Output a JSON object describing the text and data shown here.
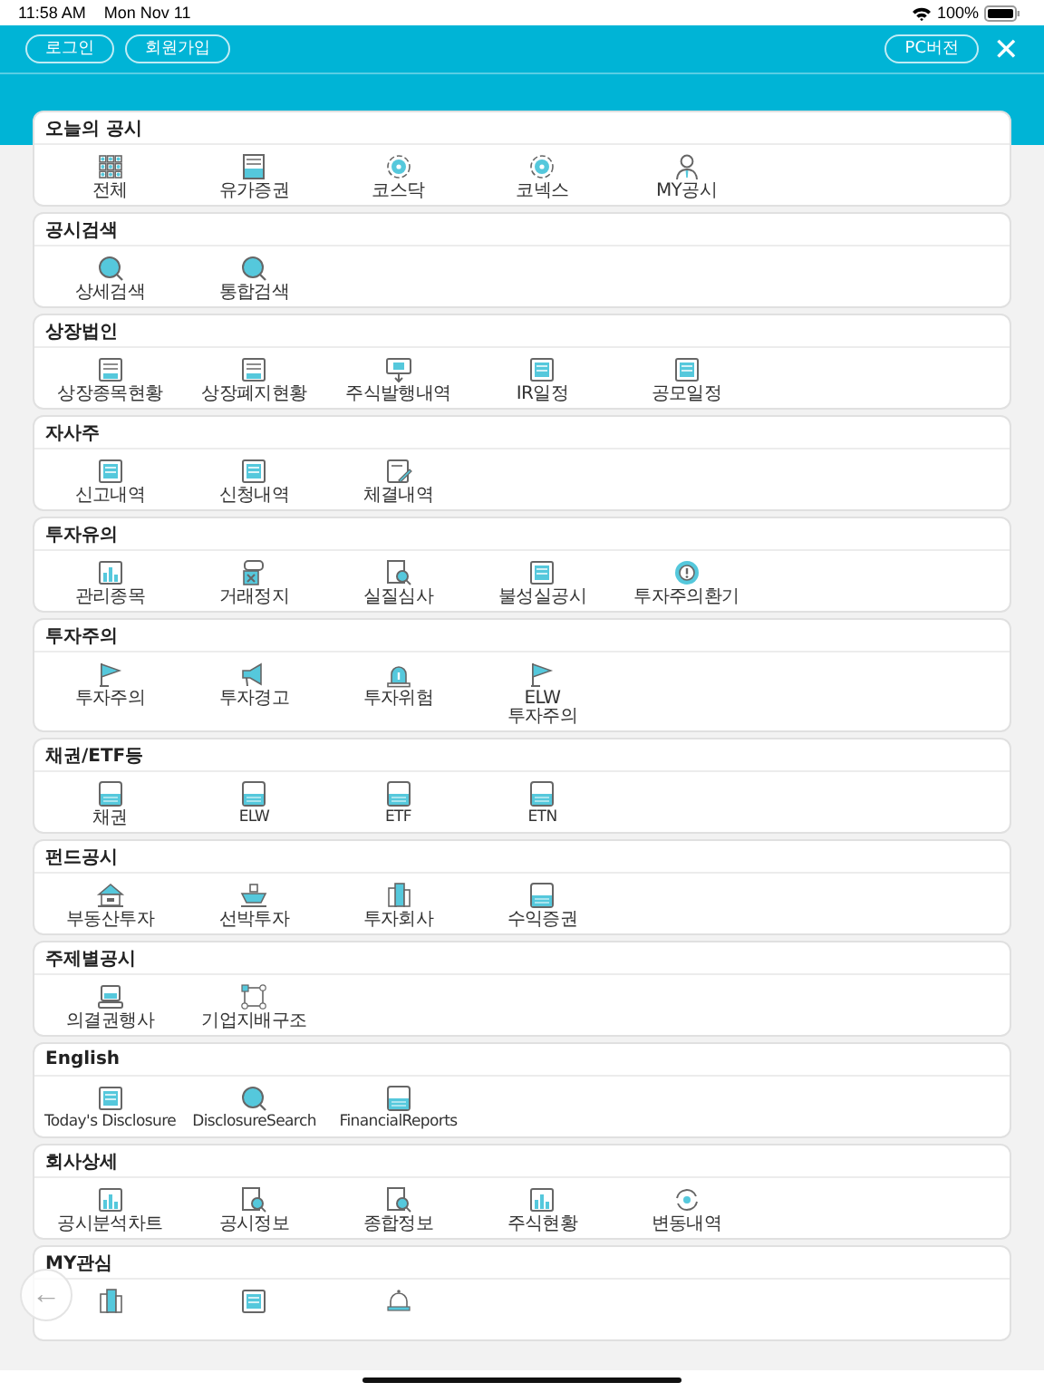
{
  "status_bar": {
    "time": "11:58 AM",
    "date": "Mon Nov 11",
    "battery": "100%"
  },
  "header": {
    "buttons": [
      "로그인",
      "회원가입"
    ],
    "pc_button": "PC버전",
    "close": "✕"
  },
  "sections": [
    {
      "title": "오늘의 공시",
      "items": [
        {
          "label": "전체",
          "kind": "grid"
        },
        {
          "label": "유가증권",
          "kind": "ledger"
        },
        {
          "label": "코스닥",
          "kind": "target"
        },
        {
          "label": "코넥스",
          "kind": "target"
        },
        {
          "label": "MY공시",
          "kind": "person"
        }
      ]
    },
    {
      "title": "공시검색",
      "items": [
        {
          "label": "상세검색",
          "kind": "search"
        },
        {
          "label": "통합검색",
          "kind": "search"
        }
      ]
    },
    {
      "title": "상장법인",
      "items": [
        {
          "label": "상장종목현황",
          "kind": "list"
        },
        {
          "label": "상장폐지현황",
          "kind": "list"
        },
        {
          "label": "주식발행내역",
          "kind": "monitor"
        },
        {
          "label": "IR일정",
          "kind": "document"
        },
        {
          "label": "공모일정",
          "kind": "document"
        }
      ]
    },
    {
      "title": "자사주",
      "items": [
        {
          "label": "신고내역",
          "kind": "document"
        },
        {
          "label": "신청내역",
          "kind": "document"
        },
        {
          "label": "체결내역",
          "kind": "pen"
        }
      ]
    },
    {
      "title": "투자유의",
      "items": [
        {
          "label": "관리종목",
          "kind": "chart"
        },
        {
          "label": "거래정지",
          "kind": "stop"
        },
        {
          "label": "실질심사",
          "kind": "docsearch"
        },
        {
          "label": "불성실공시",
          "kind": "document"
        },
        {
          "label": "투자주의환기",
          "kind": "alert"
        }
      ]
    },
    {
      "title": "투자주의",
      "items": [
        {
          "label": "투자주의",
          "kind": "flag"
        },
        {
          "label": "투자경고",
          "kind": "megaphone"
        },
        {
          "label": "투자위험",
          "kind": "siren"
        },
        {
          "label": "ELW\n투자주의",
          "kind": "flag"
        }
      ]
    },
    {
      "title": "채권/ETF등",
      "items": [
        {
          "label": "채권",
          "kind": "card"
        },
        {
          "label": "ELW",
          "kind": "card"
        },
        {
          "label": "ETF",
          "kind": "card"
        },
        {
          "label": "ETN",
          "kind": "card"
        }
      ]
    },
    {
      "title": "펀드공시",
      "items": [
        {
          "label": "부동산투자",
          "kind": "house"
        },
        {
          "label": "선박투자",
          "kind": "ship"
        },
        {
          "label": "투자회사",
          "kind": "building"
        },
        {
          "label": "수익증권",
          "kind": "card"
        }
      ]
    },
    {
      "title": "주제별공시",
      "items": [
        {
          "label": "의결권행사",
          "kind": "laptop"
        },
        {
          "label": "기업지배구조",
          "kind": "network"
        }
      ]
    },
    {
      "title": "English",
      "items": [
        {
          "label": "Today's Disclosure",
          "kind": "document"
        },
        {
          "label": "DisclosureSearch",
          "kind": "search"
        },
        {
          "label": "FinancialReports",
          "kind": "card"
        }
      ]
    },
    {
      "title": "회사상세",
      "items": [
        {
          "label": "공시분석차트",
          "kind": "chart"
        },
        {
          "label": "공시정보",
          "kind": "docsearch"
        },
        {
          "label": "종합정보",
          "kind": "docsearch"
        },
        {
          "label": "주식현황",
          "kind": "chart"
        },
        {
          "label": "변동내역",
          "kind": "refresh"
        }
      ]
    },
    {
      "title": "MY관심",
      "items": [
        {
          "kind": "building"
        },
        {
          "kind": "document"
        },
        {
          "kind": "bell"
        }
      ]
    }
  ],
  "back_button": "←"
}
